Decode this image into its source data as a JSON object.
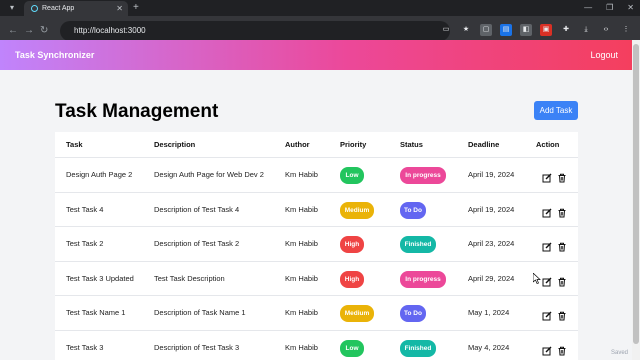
{
  "browser": {
    "tab_title": "React App",
    "new_tab": "+",
    "url": "http://localhost:3000"
  },
  "header": {
    "brand": "Task Synchronizer",
    "logout": "Logout",
    "gradient": [
      "#c084fc",
      "#ec4899",
      "#f43f5e"
    ]
  },
  "main": {
    "title": "Task Management",
    "add_button": "Add Task",
    "columns": [
      "Task",
      "Description",
      "Author",
      "Priority",
      "Status",
      "Deadline",
      "Action"
    ],
    "rows": [
      {
        "task": "Design Auth Page 2",
        "description": "Design Auth Page for Web Dev 2",
        "author": "Km Habib",
        "priority": "Low",
        "status": "In progress",
        "deadline": "April 19, 2024"
      },
      {
        "task": "Test Task 4",
        "description": "Description of Test Task 4",
        "author": "Km Habib",
        "priority": "Medium",
        "status": "To Do",
        "deadline": "April 19, 2024"
      },
      {
        "task": "Test Task 2",
        "description": "Description of Test Task 2",
        "author": "Km Habib",
        "priority": "High",
        "status": "Finished",
        "deadline": "April 23, 2024"
      },
      {
        "task": "Test Task 3 Updated",
        "description": "Test Task Description",
        "author": "Km Habib",
        "priority": "High",
        "status": "In progress",
        "deadline": "April 29, 2024"
      },
      {
        "task": "Test Task Name 1",
        "description": "Description of Task Name 1",
        "author": "Km Habib",
        "priority": "Medium",
        "status": "To Do",
        "deadline": "May 1, 2024"
      },
      {
        "task": "Test Task 3",
        "description": "Description of Test Task 3",
        "author": "Km Habib",
        "priority": "Low",
        "status": "Finished",
        "deadline": "May 4, 2024"
      }
    ],
    "action_icons": [
      "edit-icon",
      "trash-icon"
    ]
  },
  "colors": {
    "accent": "#3b82f6",
    "priority": {
      "Low": "#22c55e",
      "Medium": "#eab308",
      "High": "#ef4444"
    },
    "status": {
      "In progress": "#ec4899",
      "To Do": "#6366f1",
      "Finished": "#14b8a6"
    }
  },
  "watermark": "Saved"
}
